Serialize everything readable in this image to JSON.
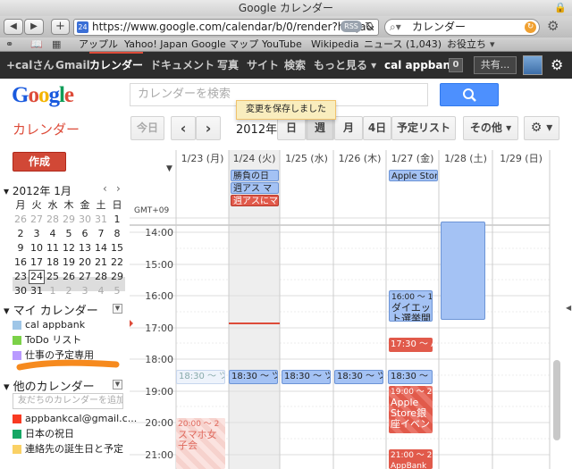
{
  "window": {
    "title": "Google カレンダー"
  },
  "toolbar": {
    "back": "◀",
    "forward": "▶",
    "plus": "+",
    "url": "https://www.google.com/calendar/b/0/render?hl=ja&",
    "favicon": "24",
    "rss": "RSS",
    "search": "カレンダー"
  },
  "bookmarks": [
    "アップル",
    "Yahoo! Japan",
    "Google マップ",
    "YouTube",
    "Wikipedia",
    "ニュース (1,043)",
    "お役立ち"
  ],
  "gbar": {
    "items": [
      "+calさん",
      "Gmail",
      "カレンダー",
      "ドキュメント",
      "写真",
      "サイト",
      "検索",
      "もっと見る ▾"
    ],
    "account": "cal appbank",
    "count": "0",
    "share": "共有..."
  },
  "header": {
    "logo": [
      "G",
      "o",
      "o",
      "g",
      "l",
      "e"
    ],
    "search_placeholder": "カレンダーを検索",
    "saved_message": "変更を保存しました"
  },
  "colors": {
    "blue": "#1a5ade",
    "red": "#dd4b39",
    "yellow": "#f4b400",
    "green": "#0f9d58",
    "event_blue": "#a4c2f4",
    "event_red": "#e15a4b"
  },
  "nav": {
    "app": "カレンダー",
    "today": "今日",
    "prev": "‹",
    "next": "›",
    "range": "2012年",
    "views": [
      "日",
      "週",
      "月",
      "4日",
      "予定リスト"
    ],
    "other": "その他 ▾",
    "settings": "⚙ ▾"
  },
  "left": {
    "create": "作成",
    "month": "2012年 1月",
    "weekdays": [
      "月",
      "火",
      "水",
      "木",
      "金",
      "土",
      "日"
    ],
    "weeks": [
      [
        "26",
        "27",
        "28",
        "29",
        "30",
        "31",
        "1"
      ],
      [
        "2",
        "3",
        "4",
        "5",
        "6",
        "7",
        "8"
      ],
      [
        "9",
        "10",
        "11",
        "12",
        "13",
        "14",
        "15"
      ],
      [
        "16",
        "17",
        "18",
        "19",
        "20",
        "21",
        "22"
      ],
      [
        "23",
        "24",
        "25",
        "26",
        "27",
        "28",
        "29"
      ],
      [
        "30",
        "31",
        "1",
        "2",
        "3",
        "4",
        "5"
      ]
    ],
    "my_calendars": "マイ カレンダー",
    "my_items": [
      {
        "name": "cal appbank",
        "color": "#9fc6e7"
      },
      {
        "name": "ToDo リスト",
        "color": "#7bd148"
      },
      {
        "name": "仕事の予定専用",
        "color": "#b99aff"
      }
    ],
    "other_calendars": "他のカレンダー",
    "friend_placeholder": "友だちのカレンダーを追加",
    "other_items": [
      {
        "name": "appbankcal@gmail.c...",
        "color": "#f83a22"
      },
      {
        "name": "日本の祝日",
        "color": "#16a765"
      },
      {
        "name": "連絡先の誕生日と予定",
        "color": "#fad165"
      }
    ]
  },
  "grid": {
    "gmt": "GMT+09",
    "days": [
      "1/23 (月)",
      "1/24 (火)",
      "1/25 (水)",
      "1/26 (木)",
      "1/27 (金)",
      "1/28 (土)",
      "1/29 (日)"
    ],
    "times": [
      "14:00",
      "15:00",
      "16:00",
      "17:00",
      "18:00",
      "19:00",
      "20:00",
      "21:00"
    ],
    "allday": {
      "e1": "勝負の日",
      "e2": "週アス マ",
      "e3": "週アスにマ",
      "e4": "Apple Stor"
    },
    "events": {
      "a": "18:30 ～ ツ",
      "b": "18:30 ～ ツ",
      "c": "18:30 ～ ツ",
      "d": "18:30 ～ ツ",
      "e": "18:30 ～ ツ",
      "f1": "16:00 ～ 1",
      "f2": "ダイエッ",
      "f3": "ト選挙開",
      "g": "17:30 ～ A",
      "h1": "19:00 ～ 2",
      "h2": "Apple",
      "h3": "Store銀",
      "h4": "座イベン",
      "i1": "20:00 ～ 2",
      "i2": "スマホ女",
      "i3": "子会",
      "j1": "21:00 ～ 2",
      "j2": "AppBank"
    }
  }
}
